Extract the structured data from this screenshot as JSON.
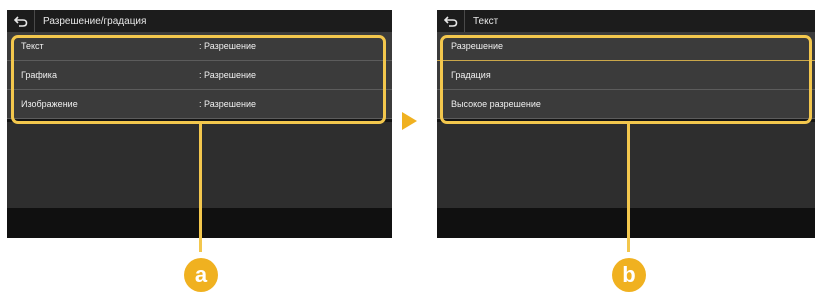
{
  "screen_a": {
    "title": "Разрешение/градация",
    "rows": [
      {
        "label": "Текст",
        "value": ": Разрешение"
      },
      {
        "label": "Графика",
        "value": ": Разрешение"
      },
      {
        "label": "Изображение",
        "value": ": Разрешение"
      }
    ]
  },
  "screen_b": {
    "title": "Текст",
    "rows": [
      {
        "label": "Разрешение"
      },
      {
        "label": "Градация"
      },
      {
        "label": "Высокое разрешение"
      }
    ]
  },
  "callouts": {
    "a": "a",
    "b": "b"
  },
  "colors": {
    "highlight": "#f3c74d",
    "marker": "#f0b120",
    "screen_bg": "#141414",
    "row_bg": "#3b3b3b"
  }
}
